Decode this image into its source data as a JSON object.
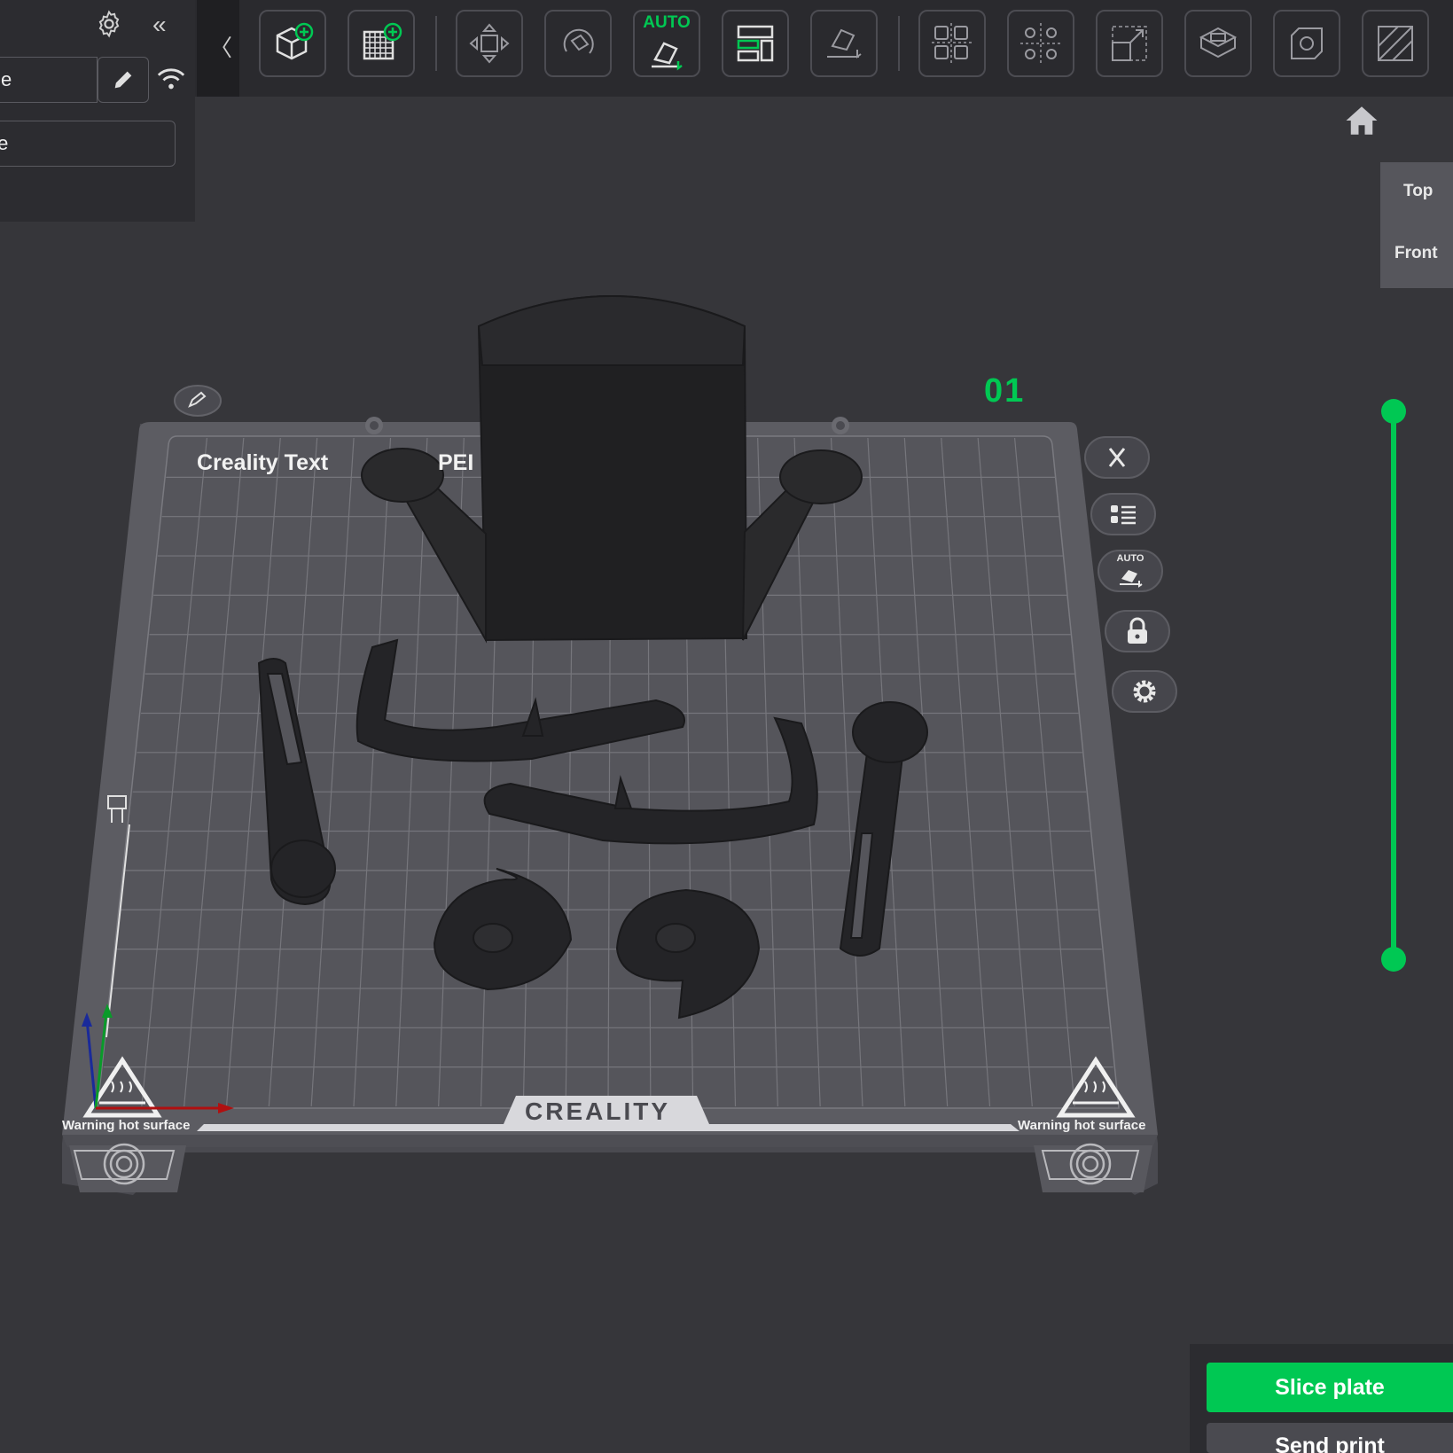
{
  "left_panel": {
    "printer_name_fragment": "tle",
    "plate_type_fragment": "te",
    "icons": [
      "gear-icon",
      "double-chevron-left-icon",
      "pencil-icon",
      "wifi-icon"
    ]
  },
  "toolbar": {
    "collapse_glyph": "〈",
    "auto_orient_label": "AUTO",
    "buttons": [
      "add-object",
      "add-plate",
      "move",
      "rotate",
      "auto-orient",
      "arrange",
      "lay-flat",
      "split-to-objects",
      "split-to-parts",
      "scale",
      "cut",
      "boolean",
      "paint"
    ]
  },
  "view_tabs": {
    "top": "Top",
    "front": "Front"
  },
  "plate": {
    "number": "01",
    "name": "Creality Text",
    "name_tail": "PEI",
    "brand": "CREALITY",
    "warning_left": "Warning hot surface",
    "warning_right": "Warning hot surface",
    "plate_buttons": [
      "close",
      "object-list",
      "auto-orient",
      "lock",
      "settings"
    ],
    "plate_auto_label": "AUTO"
  },
  "actions": {
    "slice_label": "Slice plate",
    "send_label": "Send print"
  },
  "colors": {
    "accent": "#00c853",
    "background": "#36363a",
    "toolbar": "#2a2a2e",
    "bed": "#5c5c62",
    "model": "#222224"
  }
}
